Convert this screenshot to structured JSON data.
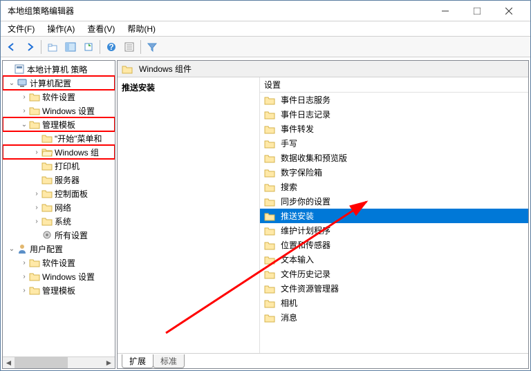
{
  "window": {
    "title": "本地组策略编辑器"
  },
  "menu": {
    "file": "文件(F)",
    "action": "操作(A)",
    "view": "查看(V)",
    "help": "帮助(H)"
  },
  "tree": {
    "root": "本地计算机 策略",
    "computer_config": "计算机配置",
    "software_settings": "软件设置",
    "windows_settings": "Windows 设置",
    "admin_templates": "管理模板",
    "start_menu": "\"开始\"菜单和",
    "windows_components": "Windows 组",
    "printers": "打印机",
    "servers": "服务器",
    "control_panel": "控制面板",
    "network": "网络",
    "system": "系统",
    "all_settings": "所有设置",
    "user_config": "用户配置",
    "u_software": "软件设置",
    "u_windows": "Windows 设置",
    "u_admin": "管理模板"
  },
  "path": {
    "label": "Windows 组件"
  },
  "desc": {
    "title": "推送安装"
  },
  "listhdr": {
    "label": "设置"
  },
  "items": [
    "事件日志服务",
    "事件日志记录",
    "事件转发",
    "手写",
    "数据收集和预览版",
    "数字保险箱",
    "搜索",
    "同步你的设置",
    "推送安装",
    "维护计划程序",
    "位置和传感器",
    "文本输入",
    "文件历史记录",
    "文件资源管理器",
    "相机",
    "消息"
  ],
  "selected_index": 8,
  "tabs": {
    "extended": "扩展",
    "standard": "标准"
  }
}
